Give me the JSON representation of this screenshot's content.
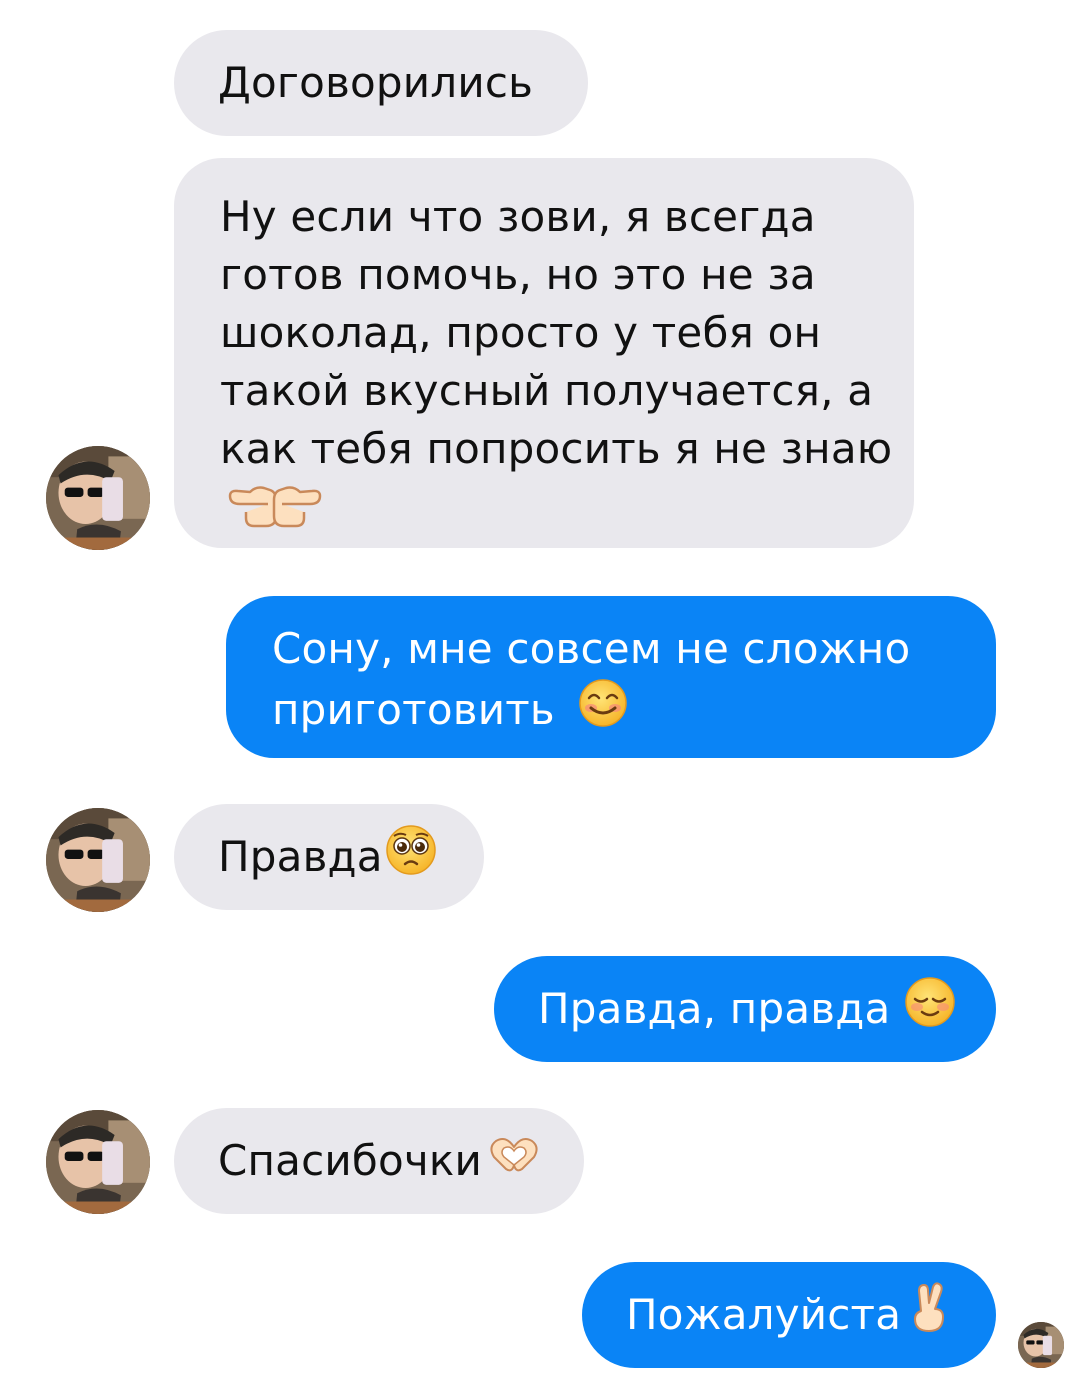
{
  "messages": [
    {
      "id": "m1",
      "side": "in",
      "lines": [
        "Договорились"
      ]
    },
    {
      "id": "m2",
      "side": "in",
      "lines": [
        "Ну если что зови, я всегда",
        "готов помочь, но это не за",
        "шоколад, просто у тебя он",
        "такой вкусный получается, а",
        "как тебя попросить я не знаю"
      ],
      "emoji": "pointing-fingers-together"
    },
    {
      "id": "m3",
      "side": "out",
      "lines": [
        "Сону, мне совсем не сложно",
        "приготовить"
      ],
      "emoji": "smiling-face-blush"
    },
    {
      "id": "m4",
      "side": "in",
      "lines": [
        "Правда"
      ],
      "emoji": "pleading-face"
    },
    {
      "id": "m5",
      "side": "out",
      "lines": [
        "Правда, правда"
      ],
      "emoji": "relieved-face"
    },
    {
      "id": "m6",
      "side": "in",
      "lines": [
        "Спасибочки"
      ],
      "emoji": "heart-hands"
    },
    {
      "id": "m7",
      "side": "out",
      "lines": [
        "Пожалуйста"
      ],
      "emoji": "crossed-fingers"
    }
  ],
  "avatar": {
    "icon": "contact-avatar"
  },
  "colors": {
    "incoming_bubble": "#e9e8ed",
    "outgoing_bubble": "#0a84f6",
    "background": "#ffffff"
  }
}
